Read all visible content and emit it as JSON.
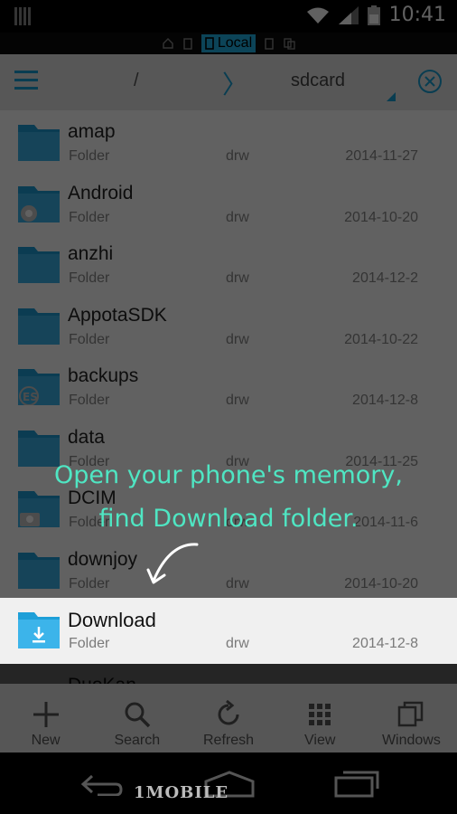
{
  "status_bar": {
    "time": "10:41"
  },
  "location_bar": {
    "active_label": "Local"
  },
  "toolbar": {
    "root": "/",
    "separator": "〉",
    "crumb": "sdcard"
  },
  "files": [
    {
      "name": "amap",
      "type": "Folder",
      "perm": "drw",
      "date": "2014-11-27",
      "badge": ""
    },
    {
      "name": "Android",
      "type": "Folder",
      "perm": "drw",
      "date": "2014-10-20",
      "badge": "gear"
    },
    {
      "name": "anzhi",
      "type": "Folder",
      "perm": "drw",
      "date": "2014-12-2",
      "badge": ""
    },
    {
      "name": "AppotaSDK",
      "type": "Folder",
      "perm": "drw",
      "date": "2014-10-22",
      "badge": ""
    },
    {
      "name": "backups",
      "type": "Folder",
      "perm": "drw",
      "date": "2014-12-8",
      "badge": "es"
    },
    {
      "name": "data",
      "type": "Folder",
      "perm": "drw",
      "date": "2014-11-25",
      "badge": ""
    },
    {
      "name": "DCIM",
      "type": "Folder",
      "perm": "drw",
      "date": "2014-11-6",
      "badge": "camera"
    },
    {
      "name": "downjoy",
      "type": "Folder",
      "perm": "drw",
      "date": "2014-10-20",
      "badge": ""
    }
  ],
  "highlighted": {
    "name": "Download",
    "type": "Folder",
    "perm": "drw",
    "date": "2014-12-8"
  },
  "partial_item": {
    "name": "DuoKan"
  },
  "actions": [
    {
      "label": "New",
      "icon": "plus-icon"
    },
    {
      "label": "Search",
      "icon": "search-icon"
    },
    {
      "label": "Refresh",
      "icon": "refresh-icon"
    },
    {
      "label": "View",
      "icon": "grid-icon"
    },
    {
      "label": "Windows",
      "icon": "windows-icon"
    }
  ],
  "tutorial": {
    "line1": "Open your phone's memory,",
    "line2": "find Download folder."
  },
  "watermark": "1MOBILE",
  "colors": {
    "accent": "#1aa0d6",
    "folder": "#1e9fd8",
    "tip": "#4fe6c3"
  }
}
